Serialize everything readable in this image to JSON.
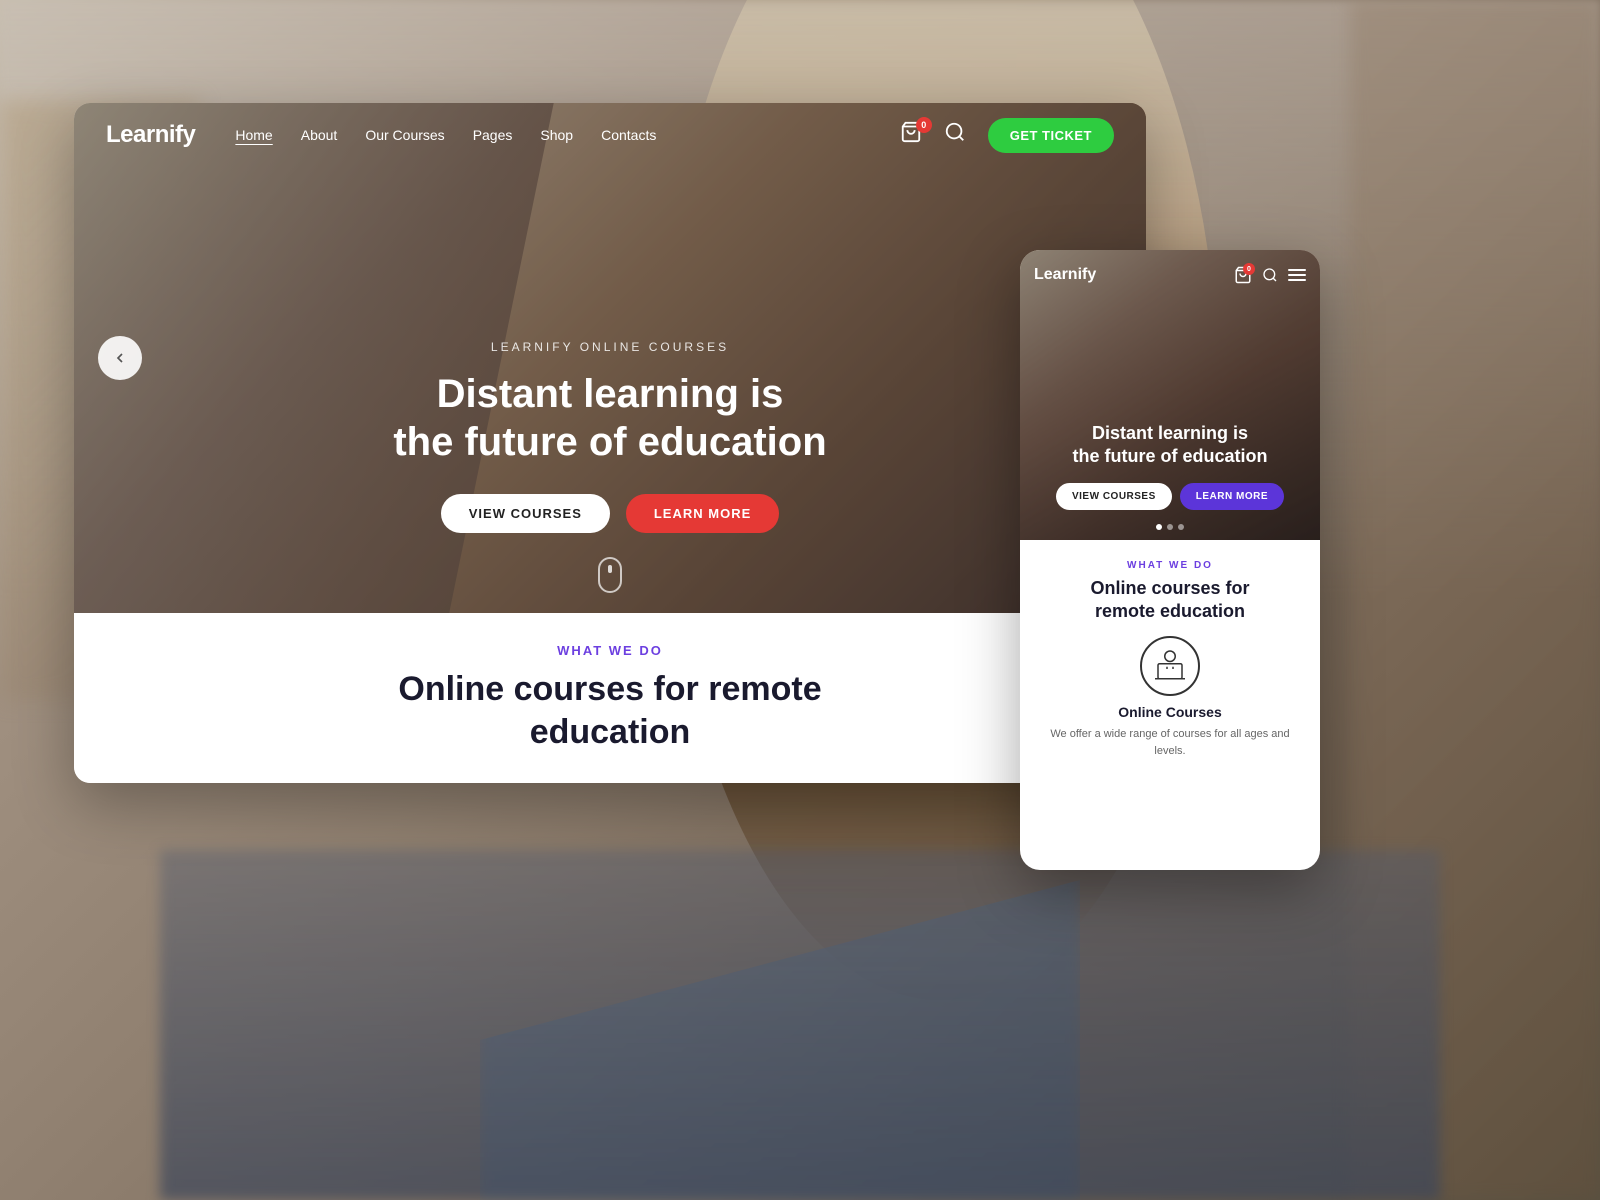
{
  "background": {
    "color": "#8a9bb0"
  },
  "desktop": {
    "logo": "Learnify",
    "nav": {
      "items": [
        {
          "label": "Home",
          "active": true
        },
        {
          "label": "About",
          "active": false
        },
        {
          "label": "Our Courses",
          "active": false
        },
        {
          "label": "Pages",
          "active": false
        },
        {
          "label": "Shop",
          "active": false
        },
        {
          "label": "Contacts",
          "active": false
        }
      ],
      "cart_count": "0",
      "get_ticket_label": "GET TICKET"
    },
    "hero": {
      "subtitle": "LEARNIFY ONLINE COURSES",
      "title_line1": "Distant learning is",
      "title_line2": "the future of education",
      "btn_view": "VIEW COURSES",
      "btn_learn": "LEARN MORE"
    },
    "what_we_do": {
      "label": "WHAT WE DO",
      "title_line1": "Online courses for remote",
      "title_line2": "education"
    }
  },
  "mobile": {
    "logo": "Learnify",
    "cart_count": "0",
    "hero": {
      "title_line1": "Distant learning is",
      "title_line2": "the future of education",
      "btn_view": "VIEW COURSES",
      "btn_learn": "LEARN MORE"
    },
    "what_we_do": {
      "label": "WHAT WE DO",
      "title_line1": "Online courses for",
      "title_line2": "remote education"
    },
    "course": {
      "name": "Online Courses",
      "description": "We offer a wide range of courses for all ages and levels."
    }
  }
}
